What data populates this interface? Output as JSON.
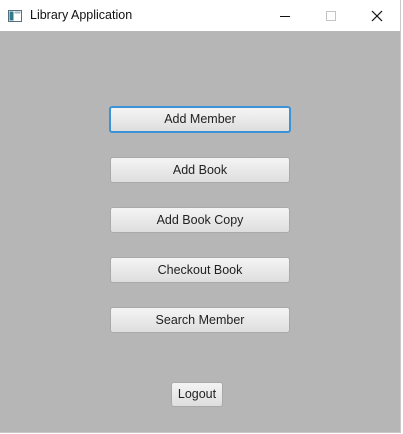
{
  "window": {
    "title": "Library Application",
    "icon": "app-window-icon",
    "controls": {
      "minimize_icon": "minimize-icon",
      "maximize_icon": "maximize-icon",
      "close_icon": "close-icon"
    }
  },
  "menu": {
    "buttons": [
      {
        "label": "Add Member",
        "focused": true
      },
      {
        "label": "Add Book"
      },
      {
        "label": "Add Book Copy"
      },
      {
        "label": "Checkout Book"
      },
      {
        "label": "Search Member"
      }
    ],
    "logout_label": "Logout"
  },
  "colors": {
    "background": "#b6b6b6",
    "focus_border": "#3b93d6",
    "titlebar": "#ffffff"
  }
}
